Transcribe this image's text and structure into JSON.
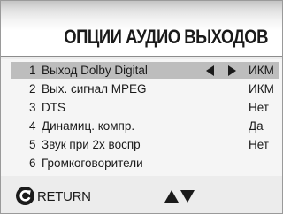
{
  "title": "ОПЦИИ АУДИО ВЫХОДОВ",
  "menu": {
    "items": [
      {
        "num": "1",
        "label": "Выход Dolby Digital",
        "value": "ИКМ",
        "selected": true
      },
      {
        "num": "2",
        "label": "Вых. сигнал MPEG",
        "value": "ИКМ"
      },
      {
        "num": "3",
        "label": "DTS",
        "value": "Нет"
      },
      {
        "num": "4",
        "label": "Динамиц. компр.",
        "value": "Да"
      },
      {
        "num": "5",
        "label": "Звук при 2х воспр",
        "value": "Нет"
      },
      {
        "num": "6",
        "label": "Громкоговорители",
        "value": ""
      }
    ]
  },
  "footer": {
    "return_label": "RETURN",
    "return_icon": "return-icon",
    "nav_icon": "up-down-arrows-icon"
  },
  "colors": {
    "highlight": "#bdbdbd",
    "text": "#1a1a1a"
  }
}
